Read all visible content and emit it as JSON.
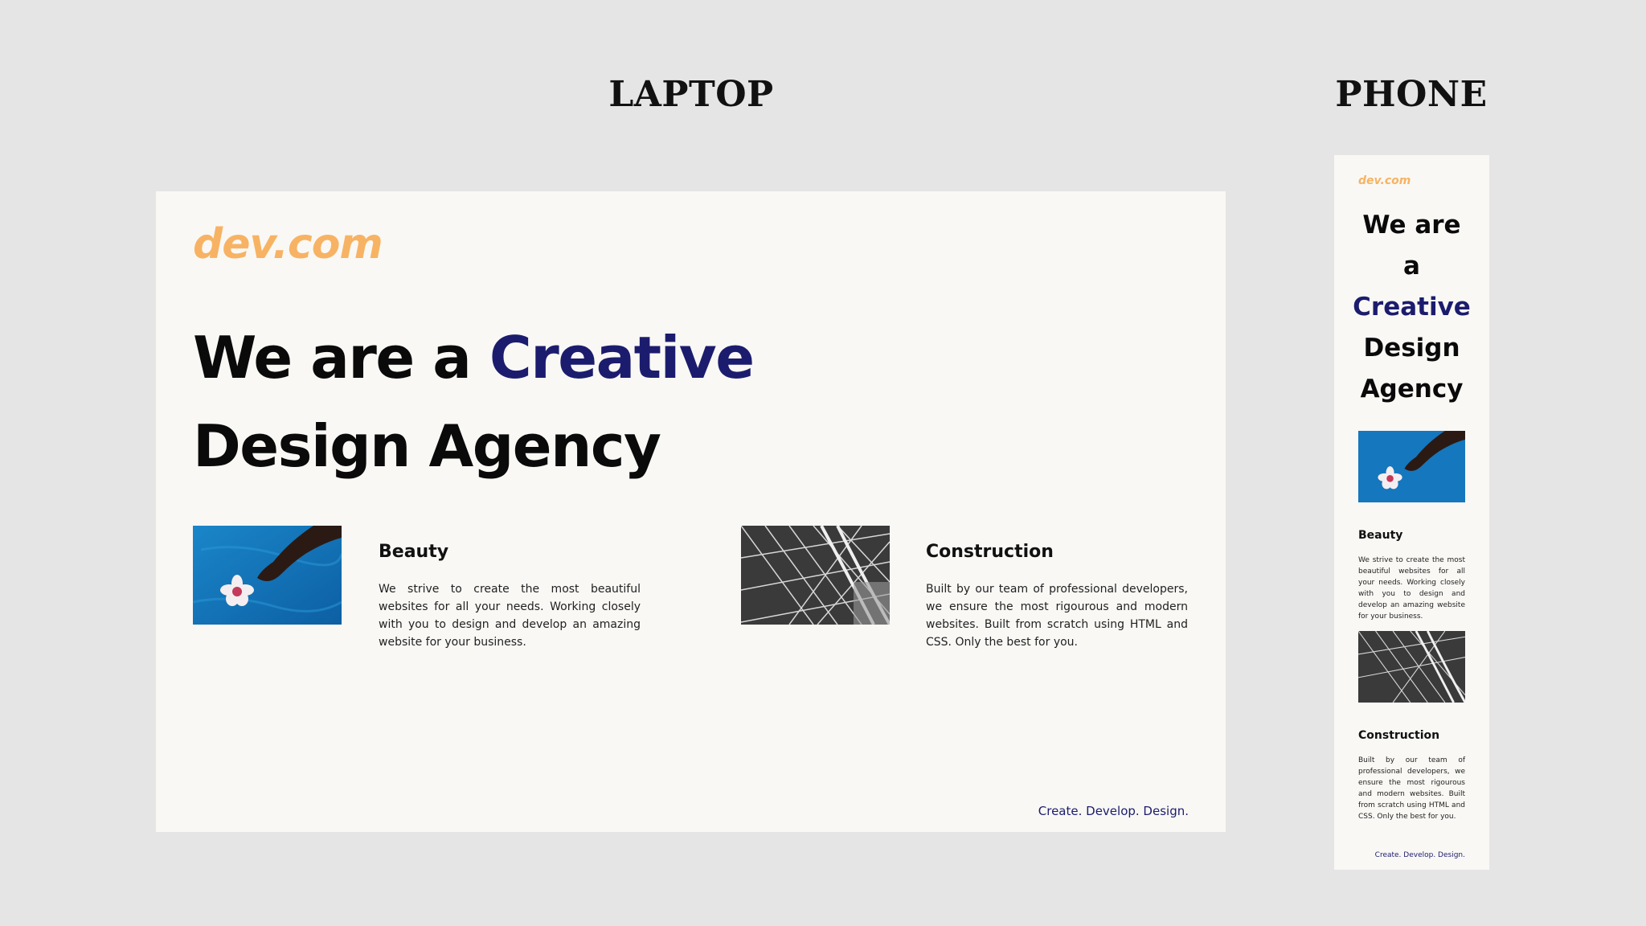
{
  "labels": {
    "laptop": "LAPTOP",
    "phone": "PHONE"
  },
  "site": {
    "logo": "dev.com",
    "headline_start": "We are a ",
    "headline_accent": "Creative",
    "headline_end": "Design Agency",
    "footer": "Create. Develop. Design.",
    "colors": {
      "logo": "#f7b363",
      "accent": "#1c1c6e",
      "background": "#f9f8f5",
      "page_background": "#e5e5e5"
    },
    "features": [
      {
        "title": "Beauty",
        "text": "We strive to create the most beautiful websites for all your needs. Working closely with you to design and develop an amazing website for your business.",
        "image": "blue-water-hand-flower-image"
      },
      {
        "title": "Construction",
        "text": "Built by our team of professional developers, we ensure the most rigourous and modern websites. Built from scratch using HTML and CSS. Only the best for you.",
        "image": "black-white-steel-structure-image"
      }
    ]
  },
  "phone": {
    "headline_line1": "We are",
    "headline_line2": "a"
  }
}
